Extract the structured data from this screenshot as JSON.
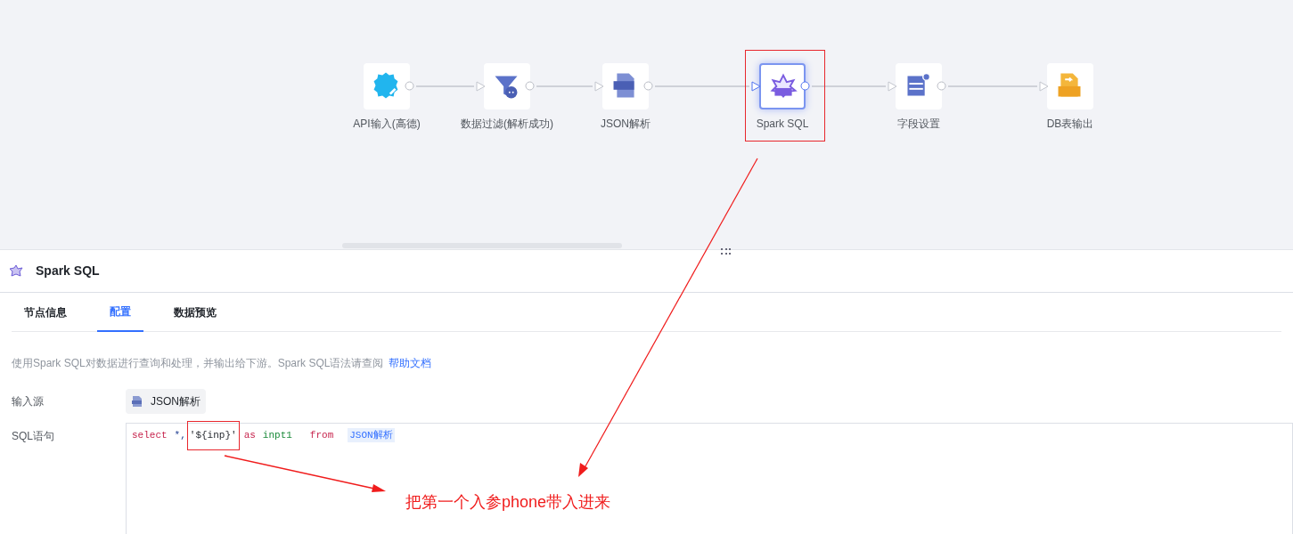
{
  "flow": {
    "nodes": [
      {
        "label": "API输入(高德)",
        "kind": "api",
        "selected": false
      },
      {
        "label": "数据过滤(解析成功)",
        "kind": "filter",
        "selected": false
      },
      {
        "label": "JSON解析",
        "kind": "json",
        "selected": false
      },
      {
        "label": "Spark SQL",
        "kind": "sql",
        "selected": true
      },
      {
        "label": "字段设置",
        "kind": "fields",
        "selected": false
      },
      {
        "label": "DB表输出",
        "kind": "db",
        "selected": false
      }
    ]
  },
  "panel": {
    "title": "Spark SQL",
    "tabs": [
      {
        "label": "节点信息",
        "selected": false
      },
      {
        "label": "配置",
        "selected": true
      },
      {
        "label": "数据预览",
        "selected": false
      }
    ],
    "description": "使用Spark SQL对数据进行查询和处理，并输出给下游。Spark SQL语法请查阅",
    "help_link": "帮助文档",
    "input_source": {
      "label": "输入源",
      "value": "JSON解析"
    },
    "sql": {
      "label": "SQL语句",
      "tokens": [
        {
          "text": "select",
          "kind": "keyword"
        },
        {
          "text": "*,",
          "kind": "plain"
        },
        {
          "text": "'${inp}'",
          "kind": "string"
        },
        {
          "text": "as",
          "kind": "keyword"
        },
        {
          "text": "inpt1",
          "kind": "identifier"
        },
        {
          "text": "from",
          "kind": "keyword"
        },
        {
          "text": "JSON解析",
          "kind": "table"
        }
      ]
    }
  },
  "annotation": {
    "text": "把第一个入参phone带入进来"
  }
}
